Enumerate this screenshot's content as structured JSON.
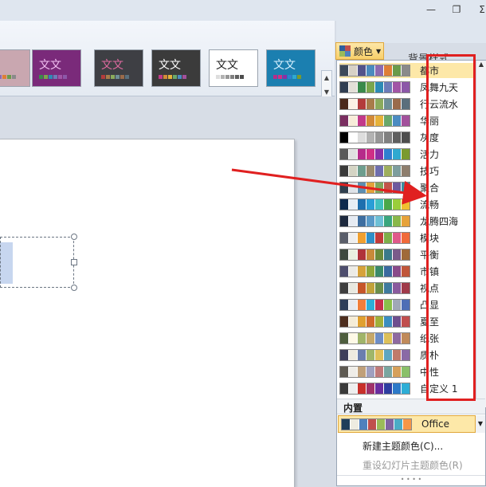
{
  "window": {
    "minimize_label": "—",
    "restore_label": "❐",
    "close_label": "Σ"
  },
  "themes": [
    {
      "label": "文",
      "bg": "#c9a7b0",
      "fg": "#d86aa0"
    },
    {
      "label": "文文",
      "bg": "#7a2a7a",
      "fg": "#f2c0f2"
    },
    {
      "label": "文文",
      "bg": "#3e3f44",
      "fg": "#e06aa0"
    },
    {
      "label": "文文",
      "bg": "#3b3b3b",
      "fg": "#ffffff"
    },
    {
      "label": "文文",
      "bg": "#ffffff",
      "fg": "#222222"
    },
    {
      "label": "文文",
      "bg": "#1b7fb0",
      "fg": "#d8f2ff"
    }
  ],
  "ribbon": {
    "colors_button_label": "颜色",
    "behind_text": "背景样式"
  },
  "dropdown": {
    "builtin_label": "内置",
    "office_label": "Office",
    "new_theme_colors": "新建主题颜色(C)...",
    "reset_slide_colors": "重设幻灯片主题颜色(R)",
    "schemes": [
      {
        "name": "都市",
        "colors": [
          "#3d4a5a",
          "#d7d1c6",
          "#53548a",
          "#4b8bbe",
          "#8c6bb1",
          "#de7e36",
          "#6a9b4a",
          "#8a8a8a"
        ]
      },
      {
        "name": "凤舞九天",
        "colors": [
          "#303e52",
          "#e3dfd7",
          "#3a8a4b",
          "#7aa64d",
          "#2e8bb5",
          "#6d7cb8",
          "#a255a6",
          "#8c58a8"
        ]
      },
      {
        "name": "行云流水",
        "colors": [
          "#4c2a1c",
          "#fbf1e5",
          "#b33b3b",
          "#a87c4a",
          "#8bab5c",
          "#6e8f96",
          "#9a6b4b",
          "#5a6f7c"
        ]
      },
      {
        "name": "华丽",
        "colors": [
          "#7a2e60",
          "#f7ecd9",
          "#c23a8a",
          "#d28a38",
          "#e6b23a",
          "#6aa86a",
          "#4b8cc2",
          "#a2519c"
        ]
      },
      {
        "name": "灰度",
        "colors": [
          "#000000",
          "#ffffff",
          "#dddddd",
          "#b2b2b2",
          "#969696",
          "#808080",
          "#5f5f5f",
          "#4d4d4d"
        ]
      },
      {
        "name": "活力",
        "colors": [
          "#5a5a5a",
          "#e0e0e0",
          "#b62b8a",
          "#cf2f86",
          "#8a2fa6",
          "#2f7fd0",
          "#2fa9d0",
          "#7a9a2f"
        ]
      },
      {
        "name": "技巧",
        "colors": [
          "#3a3a3a",
          "#d4d4c4",
          "#6e9e8e",
          "#9a8a6e",
          "#6e6eae",
          "#9eae5e",
          "#7e9e9e",
          "#8e7e6e"
        ]
      },
      {
        "name": "聚合",
        "colors": [
          "#30404e",
          "#dfe3e8",
          "#5d8eb0",
          "#e3a23a",
          "#7ea65a",
          "#c2544a",
          "#6e5a9e",
          "#3a8ea0"
        ]
      },
      {
        "name": "流畅",
        "colors": [
          "#0e2a4e",
          "#e7eef5",
          "#1e6fae",
          "#2a9ed6",
          "#40c0c0",
          "#4aa84a",
          "#9ace3a",
          "#f0c030"
        ]
      },
      {
        "name": "龙腾四海",
        "colors": [
          "#1e2a3e",
          "#e6ebf2",
          "#3e6ea0",
          "#5a9ac8",
          "#6ec0d6",
          "#3aa67e",
          "#8ab84a",
          "#e6a23a"
        ]
      },
      {
        "name": "模块",
        "colors": [
          "#5a5e6a",
          "#eeeeee",
          "#f0a030",
          "#2e8ec8",
          "#c23a3a",
          "#7eae4a",
          "#e05a8a",
          "#f06a3a"
        ]
      },
      {
        "name": "平衡",
        "colors": [
          "#3e4a3e",
          "#eaeee0",
          "#b0323a",
          "#c88a3a",
          "#6a8a3a",
          "#3a7a8a",
          "#7a5a8a",
          "#a06a3a"
        ]
      },
      {
        "name": "市镇",
        "colors": [
          "#4e4e6e",
          "#ecebe6",
          "#d6a23a",
          "#8ea63a",
          "#3a8a6a",
          "#3a6aa0",
          "#8a4a8a",
          "#c0563a"
        ]
      },
      {
        "name": "视点",
        "colors": [
          "#3e3e3e",
          "#e8e8e0",
          "#c6562a",
          "#c2a23a",
          "#6a8e4a",
          "#3e7a9e",
          "#8a5a9e",
          "#a03a4a"
        ]
      },
      {
        "name": "凸显",
        "colors": [
          "#2e3e5a",
          "#e6e9ee",
          "#f07e3a",
          "#2eaed6",
          "#c8304a",
          "#8ac04a",
          "#a0a8b6",
          "#4e6eb6"
        ]
      },
      {
        "name": "夏至",
        "colors": [
          "#4e2e1e",
          "#f5ecd6",
          "#e0a030",
          "#d06a2a",
          "#a0b03a",
          "#3a8ec0",
          "#6e4e8e",
          "#c04e4e"
        ]
      },
      {
        "name": "纸张",
        "colors": [
          "#4e5e3e",
          "#fef9e6",
          "#a0b46a",
          "#c6a86a",
          "#6e8ec6",
          "#dcc05a",
          "#8e6aa0",
          "#c08a5a"
        ]
      },
      {
        "name": "质朴",
        "colors": [
          "#3e3e5a",
          "#eeeae0",
          "#6a7eae",
          "#a0b66a",
          "#e0c05a",
          "#5ea6c0",
          "#c07a6a",
          "#8a6aa6"
        ]
      },
      {
        "name": "中性",
        "colors": [
          "#5e5a52",
          "#efede8",
          "#c0a07a",
          "#a0a0c0",
          "#c07a7a",
          "#7aa6a0",
          "#d6a05a",
          "#8ac06a"
        ]
      },
      {
        "name": "自定义 1",
        "colors": [
          "#3a3a3a",
          "#eeeeee",
          "#c8302a",
          "#a0326a",
          "#6a2ea0",
          "#2e3ea0",
          "#2e7ac8",
          "#2eaed6"
        ]
      }
    ],
    "office_colors": [
      "#1f3e5a",
      "#eeece1",
      "#4f81bd",
      "#c0504d",
      "#9bbb59",
      "#8064a2",
      "#4bacc6",
      "#f79646"
    ]
  }
}
